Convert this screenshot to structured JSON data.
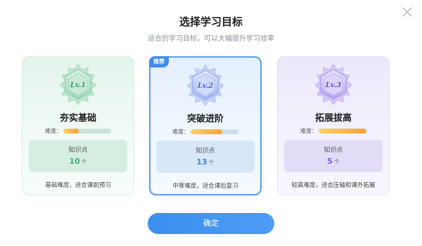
{
  "dialog": {
    "title": "选择学习目标",
    "subtitle": "适合的学习目标，可以大幅提升学习效率",
    "confirm_label": "确定"
  },
  "cards": [
    {
      "level_label": "Lv.1",
      "name": "夯实基础",
      "difficulty_label": "难度：",
      "difficulty_level": 0.33,
      "knowledge_label": "知识点",
      "knowledge_count": "10",
      "knowledge_unit": "个",
      "description": "基础难度，适合课前预习",
      "accent": "#36b27a",
      "selected": false
    },
    {
      "tag": "推荐",
      "level_label": "Lv.2",
      "name": "突破进阶",
      "difficulty_label": "难度：",
      "difficulty_level": 0.66,
      "knowledge_label": "知识点",
      "knowledge_count": "13",
      "knowledge_unit": "个",
      "description": "中等难度，适合课后复习",
      "accent": "#3c86e8",
      "selected": true
    },
    {
      "level_label": "Lv.3",
      "name": "拓展拔高",
      "difficulty_label": "难度：",
      "difficulty_level": 1.0,
      "knowledge_label": "知识点",
      "knowledge_count": "5",
      "knowledge_unit": "个",
      "description": "较高难度，适合压轴和课外拓展",
      "accent": "#7a5fe0",
      "selected": false
    }
  ],
  "icons": {
    "close": "close-icon",
    "badge": "level-badge-icon"
  },
  "colors": {
    "primary": "#3d8cf0",
    "green": "#36b27a",
    "blue": "#3c86e8",
    "purple": "#7a5fe0",
    "difficulty_fill": "#f3a23a"
  }
}
